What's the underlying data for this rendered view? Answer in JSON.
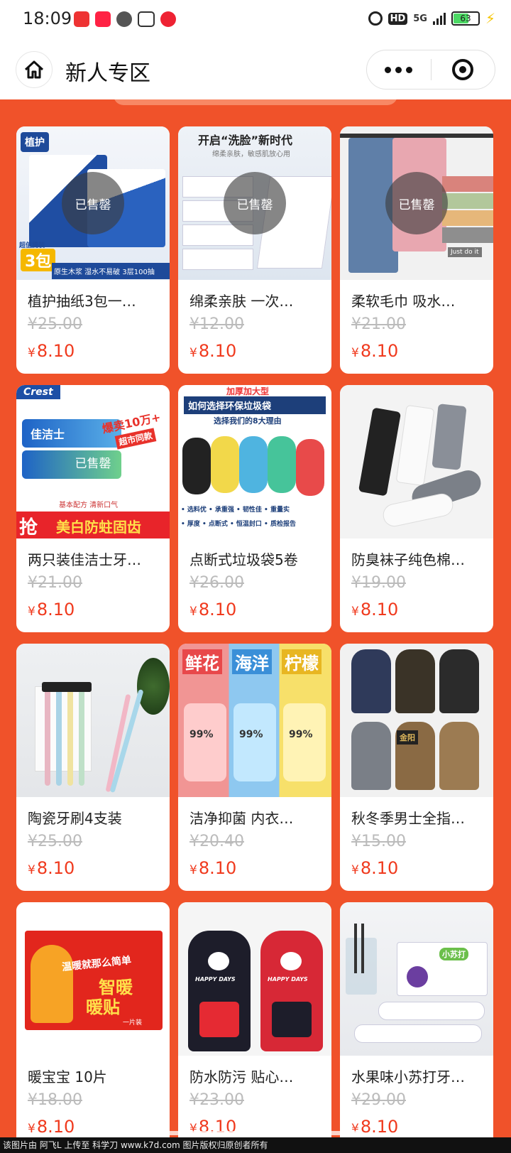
{
  "status_bar": {
    "time": "18:09",
    "network": "5G",
    "hd_badge": "HD",
    "battery_level": "63",
    "colors": {
      "charging": "#f5c400",
      "battery_fill": "#4cd964"
    }
  },
  "nav": {
    "title": "新人专区",
    "home_icon": "home-icon",
    "menu_icon": "more-dots-icon",
    "close_icon": "target-close-icon"
  },
  "theme": {
    "background": "#f0522a",
    "price_color": "#f03a1e",
    "old_price_color": "#bbbbbb"
  },
  "currency": "¥",
  "products": [
    {
      "title": "植护抽纸3包一…",
      "old_price": "¥25.00",
      "price": "8.10",
      "sold_label": "已售罄",
      "image_text": {
        "brand": "植护",
        "badge": "3包",
        "badge_caption": "超值提装",
        "banner": "原生木浆 湿水不易破 3层100抽"
      }
    },
    {
      "title": "绵柔亲肤 一次…",
      "old_price": "¥12.00",
      "price": "8.10",
      "sold_label": "已售罄",
      "image_text": {
        "headline": "开启“洗脸”新时代",
        "sub": "绵柔亲肤，敏感肌放心用"
      }
    },
    {
      "title": "柔软毛巾 吸水…",
      "old_price": "¥21.00",
      "price": "8.10",
      "sold_label": "已售罄",
      "image_text": {
        "tag": "Just do it"
      }
    },
    {
      "title": "两只装佳洁士牙…",
      "old_price": "¥21.00",
      "price": "8.10",
      "sold_label": "已售罄",
      "image_text": {
        "brand": "Crest",
        "brand_cn": "佳洁士",
        "promo": "爆卖10万+",
        "promo2": "超市同款",
        "banner_left": "抢",
        "banner": "美白防蛀固齿",
        "strip": "基本配方 清新口气"
      }
    },
    {
      "title": "点断式垃圾袋5卷",
      "old_price": "¥26.00",
      "price": "8.10",
      "sold_label": "",
      "image_text": {
        "top": "加厚加大型",
        "header": "如何选择环保垃圾袋",
        "sub": "选择我们的8大理由",
        "row1": "• 选料优  • 承重强  • 韧性佳  • 重量实",
        "row2": "• 厚度  • 点断式  • 恒温封口  • 质检报告"
      }
    },
    {
      "title": "防臭袜子纯色棉…",
      "old_price": "¥19.00",
      "price": "8.10",
      "sold_label": "",
      "image_text": {}
    },
    {
      "title": "陶瓷牙刷4支装",
      "old_price": "¥25.00",
      "price": "8.10",
      "sold_label": "",
      "image_text": {}
    },
    {
      "title": "洁净抑菌 内衣…",
      "old_price": "¥20.40",
      "price": "8.10",
      "sold_label": "",
      "image_text": {
        "c1": "鲜花",
        "c2": "海洋",
        "c3": "柠檬",
        "pct": "99%"
      }
    },
    {
      "title": "秋冬季男士全指…",
      "old_price": "¥15.00",
      "price": "8.10",
      "sold_label": "",
      "image_text": {
        "label": "金阳"
      }
    },
    {
      "title": "暖宝宝 10片",
      "old_price": "¥18.00",
      "price": "8.10",
      "sold_label": "",
      "image_text": {
        "line1": "温暖就那么简单",
        "line2": "智暖",
        "line3": "暖贴",
        "tag": "一片装"
      }
    },
    {
      "title": "防水防污 贴心…",
      "old_price": "¥23.00",
      "price": "8.10",
      "sold_label": "",
      "image_text": {
        "print": "HAPPY DAYS"
      }
    },
    {
      "title": "水果味小苏打牙…",
      "old_price": "¥29.00",
      "price": "8.10",
      "sold_label": "",
      "image_text": {
        "box": "小苏打"
      }
    }
  ],
  "footer_text": "该图片由 阿飞L 上传至 科学刀 www.k7d.com 图片版权归原创者所有"
}
